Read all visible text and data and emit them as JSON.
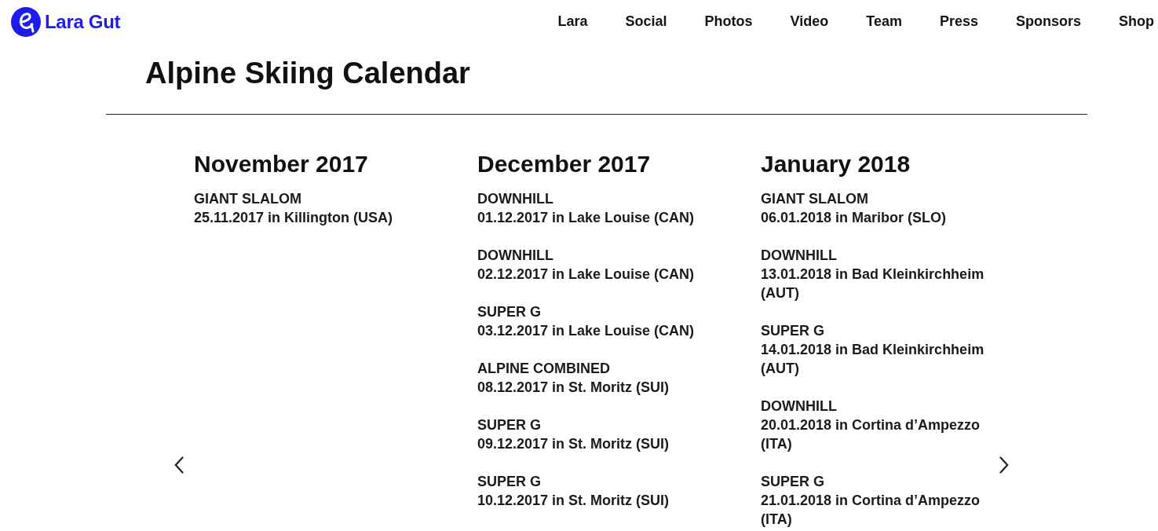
{
  "header": {
    "brand": "Lara Gut",
    "nav": [
      "Lara",
      "Social",
      "Photos",
      "Video",
      "Team",
      "Press",
      "Sponsors",
      "Shop"
    ]
  },
  "title": "Alpine Skiing Calendar",
  "calendar": {
    "months": [
      {
        "title": "November 2017",
        "events": [
          {
            "discipline": "GIANT SLALOM",
            "detail": "25.11.2017 in Killington (USA)"
          }
        ]
      },
      {
        "title": "December 2017",
        "events": [
          {
            "discipline": "DOWNHILL",
            "detail": "01.12.2017 in Lake Louise (CAN)"
          },
          {
            "discipline": "DOWNHILL",
            "detail": "02.12.2017 in Lake Louise (CAN)"
          },
          {
            "discipline": "SUPER G",
            "detail": "03.12.2017 in Lake Louise (CAN)"
          },
          {
            "discipline": "ALPINE COMBINED",
            "detail": "08.12.2017 in St. Moritz (SUI)"
          },
          {
            "discipline": "SUPER G",
            "detail": "09.12.2017 in St. Moritz (SUI)"
          },
          {
            "discipline": "SUPER G",
            "detail": "10.12.2017 in St. Moritz (SUI)"
          }
        ]
      },
      {
        "title": "January 2018",
        "events": [
          {
            "discipline": "GIANT SLALOM",
            "detail": "06.01.2018 in Maribor (SLO)"
          },
          {
            "discipline": "DOWNHILL",
            "detail": "13.01.2018 in Bad Kleinkirchheim (AUT)"
          },
          {
            "discipline": "SUPER G",
            "detail": "14.01.2018 in Bad Kleinkirchheim (AUT)"
          },
          {
            "discipline": "DOWNHILL",
            "detail": "20.01.2018 in Cortina d’Ampezzo (ITA)"
          },
          {
            "discipline": "SUPER G",
            "detail": "21.01.2018 in Cortina d’Ampezzo (ITA)"
          }
        ]
      }
    ]
  }
}
